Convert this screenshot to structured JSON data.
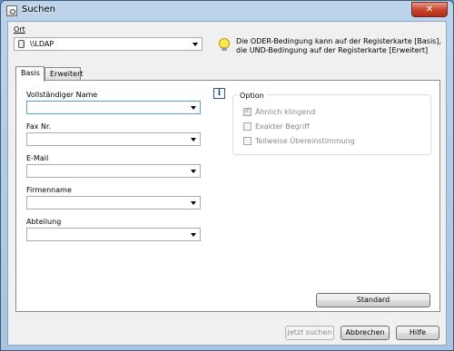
{
  "window": {
    "title": "Suchen",
    "close_label": "✕"
  },
  "ort": {
    "label": "Ort",
    "value": "\\\\LDAP"
  },
  "hint": {
    "line1": "Die ODER-Bedingung kann auf der Registerkarte [Basis],",
    "line2": "die UND-Bedingung auf der Registerkarte [Erweitert]"
  },
  "tabs": [
    {
      "label": "Basis"
    },
    {
      "label": "Erweitert"
    }
  ],
  "fields": [
    {
      "label": "Vollständiger Name",
      "value": ""
    },
    {
      "label": "Fax Nr.",
      "value": ""
    },
    {
      "label": "E-Mail",
      "value": ""
    },
    {
      "label": "Firmenname",
      "value": ""
    },
    {
      "label": "Abteilung",
      "value": ""
    }
  ],
  "option": {
    "label": "Option",
    "items": [
      {
        "label": "Ähnlich klingend",
        "checked": true
      },
      {
        "label": "Exakter Begriff",
        "checked": false
      },
      {
        "label": "Teilweise Übereinstimmung",
        "checked": false
      }
    ]
  },
  "buttons": {
    "standard": "Standard",
    "search": "Jetzt suchen",
    "cancel": "Abbrechen",
    "help": "Hilfe"
  }
}
